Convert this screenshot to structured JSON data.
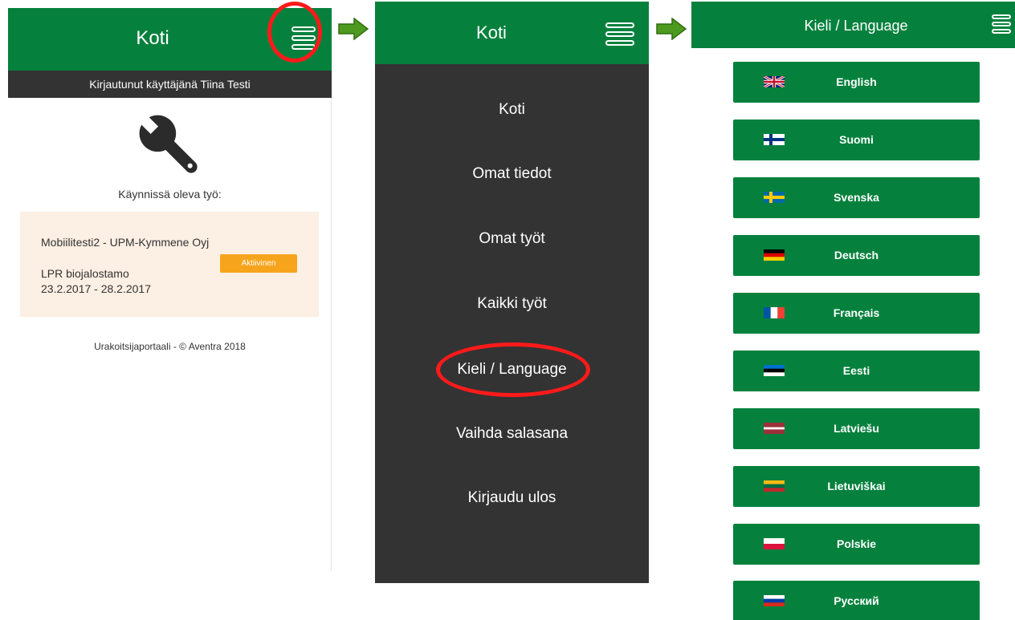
{
  "panel1": {
    "header_title": "Koti",
    "logged_in_text": "Kirjautunut käyttäjänä Tiina Testi",
    "running_job_label": "Käynnissä oleva työ:",
    "job": {
      "title": "Mobiilitesti2 - UPM-Kymmene Oyj",
      "site": "LPR biojalostamo",
      "dates": "23.2.2017 - 28.2.2017",
      "status": "Aktiivinen"
    },
    "footer": "Urakoitsijaportaali - © Aventra 2018"
  },
  "panel2": {
    "header_title": "Koti",
    "menu": [
      {
        "label": "Koti"
      },
      {
        "label": "Omat tiedot"
      },
      {
        "label": "Omat työt"
      },
      {
        "label": "Kaikki työt"
      },
      {
        "label": "Kieli / Language"
      },
      {
        "label": "Vaihda salasana"
      },
      {
        "label": "Kirjaudu ulos"
      }
    ]
  },
  "panel3": {
    "header_title": "Kieli / Language",
    "languages": [
      {
        "label": "English",
        "flag": "uk-flag-icon"
      },
      {
        "label": "Suomi",
        "flag": "finland-flag-icon"
      },
      {
        "label": "Svenska",
        "flag": "sweden-flag-icon"
      },
      {
        "label": "Deutsch",
        "flag": "germany-flag-icon"
      },
      {
        "label": "Français",
        "flag": "france-flag-icon"
      },
      {
        "label": "Eesti",
        "flag": "estonia-flag-icon"
      },
      {
        "label": "Latviešu",
        "flag": "latvia-flag-icon"
      },
      {
        "label": "Lietuviškai",
        "flag": "lithuania-flag-icon"
      },
      {
        "label": "Polskie",
        "flag": "poland-flag-icon"
      },
      {
        "label": "Русский",
        "flag": "russia-flag-icon"
      }
    ]
  },
  "colors": {
    "brand_green": "#06813d",
    "menu_dark": "#333333",
    "badge_orange": "#f7a41d",
    "card_bg": "#fcefe3",
    "highlight_red": "#ff1a1a",
    "arrow_green": "#4e9a1e"
  }
}
